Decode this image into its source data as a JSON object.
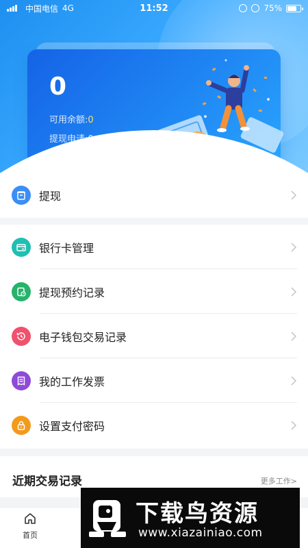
{
  "status_bar": {
    "carrier": "中国电信",
    "network": "4G",
    "time": "11:52",
    "battery": "75%",
    "battery_level": 0.75
  },
  "balance_card": {
    "amount": "0",
    "available_label": "可用余额:",
    "available_value": "0",
    "withdraw_request_label": "提现申请:",
    "withdraw_request_value": "0"
  },
  "menu_primary": [
    {
      "label": "提现",
      "icon": "withdraw-icon",
      "color": "#3a8ef5"
    }
  ],
  "menu_secondary": [
    {
      "label": "银行卡管理",
      "icon": "bank-card-icon",
      "color": "#1fbfb1"
    },
    {
      "label": "提现预约记录",
      "icon": "clock-document-icon",
      "color": "#26b36b"
    },
    {
      "label": "电子钱包交易记录",
      "icon": "history-icon",
      "color": "#f0516d"
    },
    {
      "label": "我的工作发票",
      "icon": "invoice-icon",
      "color": "#8e4bd6"
    },
    {
      "label": "设置支付密码",
      "icon": "lock-icon",
      "color": "#f39a1d"
    }
  ],
  "recent": {
    "title": "近期交易记录",
    "more": "更多工作>"
  },
  "tabbar": {
    "home_label": "首页"
  },
  "watermark": {
    "title": "下载鸟资源",
    "url": "www.xiazainiao.com"
  },
  "colors": {
    "accent": "#1f86f3",
    "highlight": "#ffe167"
  }
}
